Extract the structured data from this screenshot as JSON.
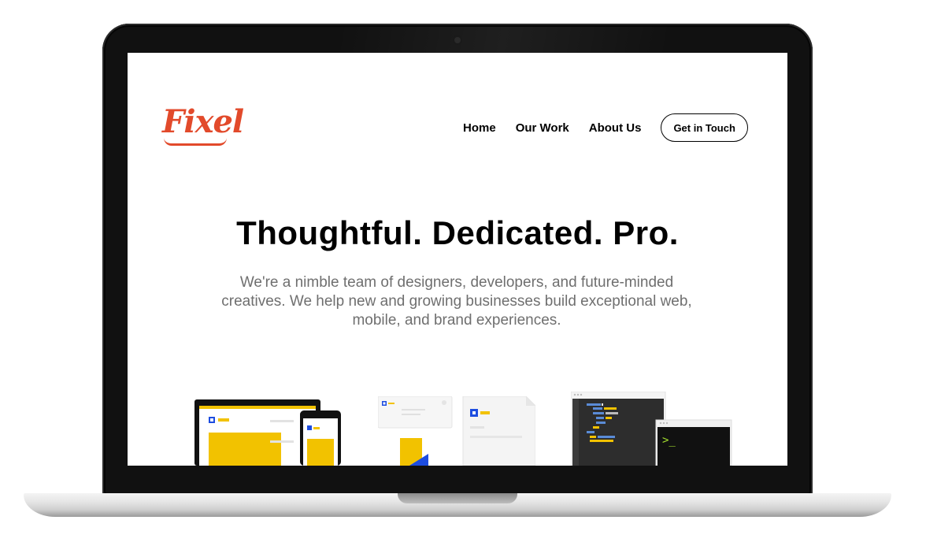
{
  "site": {
    "logo_text": "Fixel",
    "brand_color": "#e24a2b"
  },
  "nav": {
    "items": [
      "Home",
      "Our Work",
      "About Us"
    ],
    "cta_label": "Get in Touch"
  },
  "hero": {
    "title": "Thoughtful. Dedicated. Pro.",
    "description": "We're a nimble team of designers, developers, and future-minded creatives. We help new and growing businesses build exceptional web, mobile, and brand experiences."
  },
  "illustrations": {
    "devices": "devices-illustration",
    "documents": "documents-illustration",
    "code": "code-terminal-illustration",
    "terminal_prompt": ">_"
  },
  "colors": {
    "accent_yellow": "#f2c200",
    "accent_blue": "#1d4de0",
    "text_gray": "#6f6f6f"
  }
}
